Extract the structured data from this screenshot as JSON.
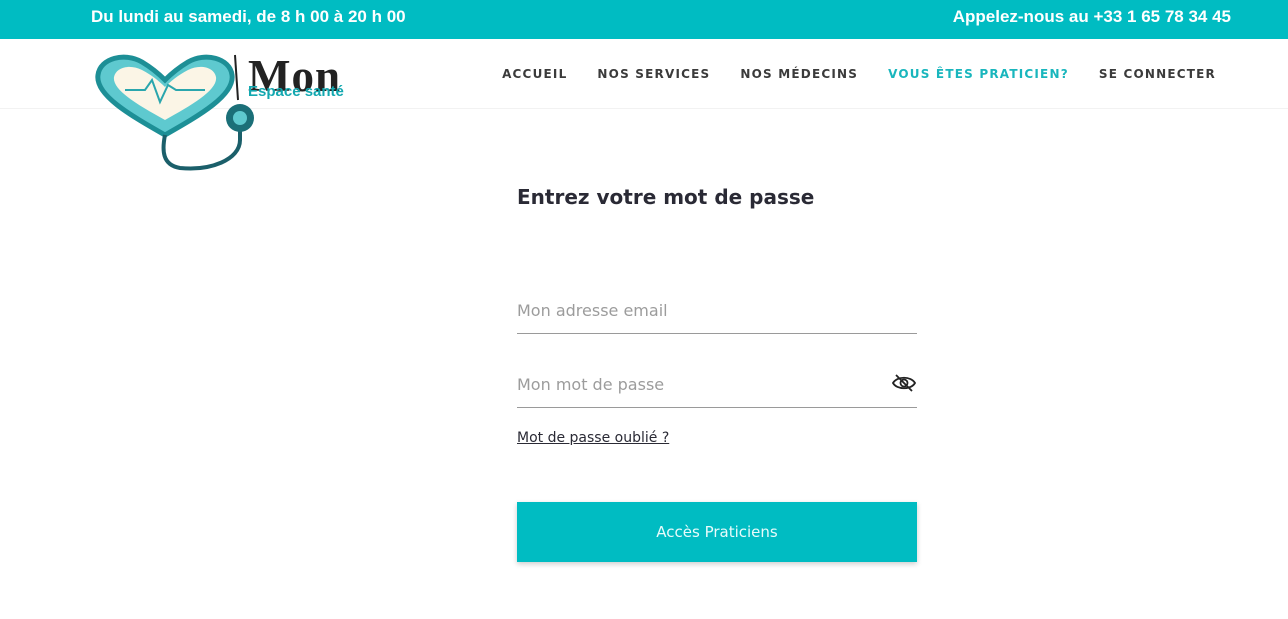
{
  "topbar": {
    "hours": "Du lundi au samedi, de 8 h 00 à 20 h 00",
    "phone": "Appelez-nous au +33 1 65 78 34 45"
  },
  "logo": {
    "word": "Mon",
    "tagline": "Espace santé"
  },
  "nav": {
    "items": [
      {
        "label": "ACCUEIL"
      },
      {
        "label": "NOS SERVICES"
      },
      {
        "label": "NOS MÉDECINS"
      },
      {
        "label": "VOUS ÊTES PRATICIEN?"
      },
      {
        "label": "SE CONNECTER"
      }
    ]
  },
  "form": {
    "title": "Entrez votre mot de passe",
    "email_placeholder": "Mon adresse email",
    "password_placeholder": "Mon mot de passe",
    "forgot_label": "Mot de passe oublié ?",
    "submit_label": "Accès Praticiens"
  },
  "colors": {
    "brand": "#00bcc2",
    "nav_active": "#19b6bd"
  },
  "icons": {
    "password_toggle": "eye-slash-icon"
  }
}
